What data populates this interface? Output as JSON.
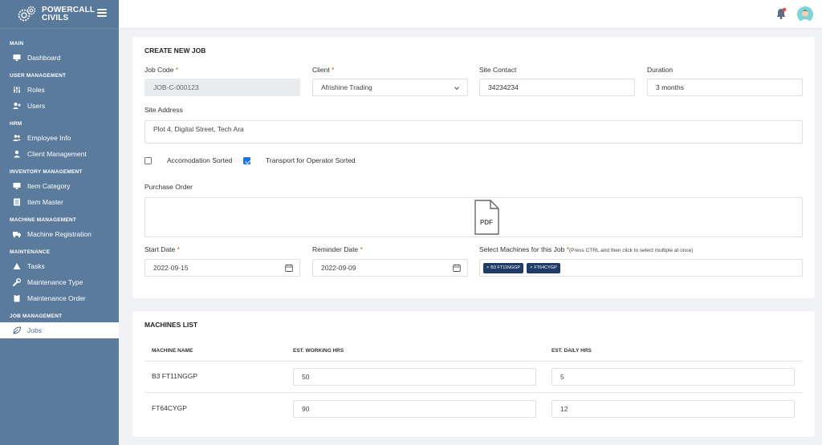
{
  "brand": {
    "line1": "POWERCALL",
    "line2": "CIVILS"
  },
  "sidebar": {
    "sections": [
      {
        "title": "MAIN",
        "items": [
          {
            "label": "Dashboard",
            "icon": "monitor-icon"
          }
        ]
      },
      {
        "title": "USER MANAGEMENT",
        "items": [
          {
            "label": "Roles",
            "icon": "sliders-icon"
          },
          {
            "label": "Users",
            "icon": "user-plus-icon"
          }
        ]
      },
      {
        "title": "HRM",
        "items": [
          {
            "label": "Employee Info",
            "icon": "users-icon"
          },
          {
            "label": "Client Management",
            "icon": "user-icon"
          }
        ]
      },
      {
        "title": "INVENTORY MANAGEMENT",
        "items": [
          {
            "label": "Item Category",
            "icon": "monitor-icon"
          },
          {
            "label": "Item Master",
            "icon": "list-icon"
          }
        ]
      },
      {
        "title": "MACHINE MANAGEMENT",
        "items": [
          {
            "label": "Machine Registration",
            "icon": "truck-icon"
          }
        ]
      },
      {
        "title": "MAINTENANCE",
        "items": [
          {
            "label": "Tasks",
            "icon": "triangle-icon"
          },
          {
            "label": "Maintenance Type",
            "icon": "wrench-icon"
          },
          {
            "label": "Maintenance Order",
            "icon": "clipboard-icon"
          }
        ]
      },
      {
        "title": "JOB MANAGEMENT",
        "items": [
          {
            "label": "Jobs",
            "icon": "leaf-icon",
            "active": true
          }
        ]
      }
    ]
  },
  "create_job": {
    "title": "CREATE NEW JOB",
    "job_code": {
      "label": "Job Code",
      "required": "*",
      "value": "JOB-C-000123"
    },
    "client": {
      "label": "Client",
      "required": "*",
      "value": "Afrishine Trading"
    },
    "site_contact": {
      "label": "Site Contact",
      "value": "34234234"
    },
    "duration": {
      "label": "Duration",
      "value": "3 months"
    },
    "site_address": {
      "label": "Site Address",
      "value": "Plot 4, Digital Street, Tech Ara"
    },
    "accommodation": {
      "label": "Accomodation Sorted",
      "checked": false
    },
    "transport": {
      "label": "Transport for Operator Sorted",
      "checked": true
    },
    "purchase_order": {
      "label": "Purchase Order",
      "file_label": "PDF"
    },
    "start_date": {
      "label": "Start Date",
      "required": "*",
      "value": "2022-09-15"
    },
    "reminder_date": {
      "label": "Reminder Date",
      "required": "*",
      "value": "2022-09-09"
    },
    "machines_select": {
      "label": "Select Machines for this Job",
      "required": "*",
      "hint": "(Press CTRL and then click to select multiple at once)",
      "tags": [
        "B3 FT11NGGP",
        "FT64CYGP"
      ],
      "remove_glyph": "×"
    }
  },
  "machines_list": {
    "title": "MACHINES LIST",
    "columns": [
      "MACHINE NAME",
      "EST. WORKING HRS",
      "EST. DAILY HRS"
    ],
    "rows": [
      {
        "name": "B3 FT11NGGP",
        "working_hrs": "50",
        "daily_hrs": "5"
      },
      {
        "name": "FT64CYGP",
        "working_hrs": "90",
        "daily_hrs": "12"
      }
    ]
  },
  "colors": {
    "sidebar": "#5a7b9c",
    "accent": "#1a73e8",
    "tag": "#1f3b66",
    "required": "#e74c3c"
  }
}
